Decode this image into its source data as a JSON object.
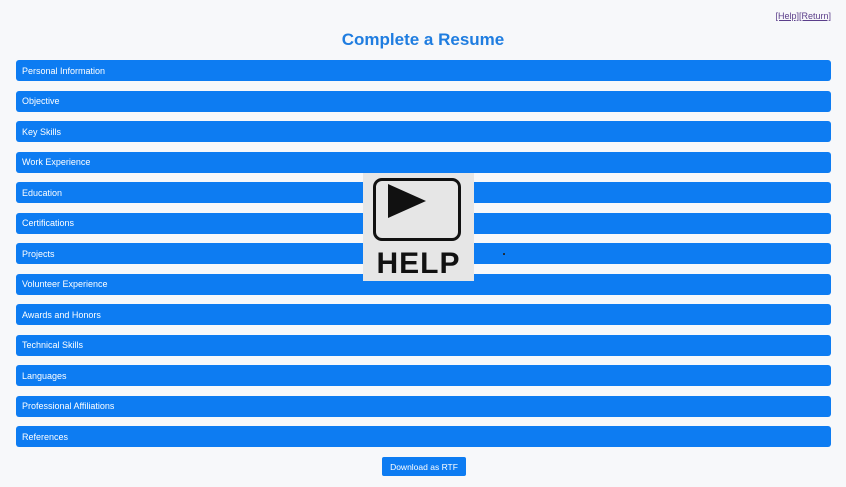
{
  "header": {
    "help_link": "[Help]",
    "return_link": "[Return]",
    "title": "Complete a Resume"
  },
  "sections": [
    {
      "label": "Personal Information"
    },
    {
      "label": "Objective"
    },
    {
      "label": "Key Skills"
    },
    {
      "label": "Work Experience"
    },
    {
      "label": "Education"
    },
    {
      "label": "Certifications"
    },
    {
      "label": "Projects"
    },
    {
      "label": "Volunteer Experience"
    },
    {
      "label": "Awards and Honors"
    },
    {
      "label": "Technical Skills"
    },
    {
      "label": "Languages"
    },
    {
      "label": "Professional Affiliations"
    },
    {
      "label": "References"
    }
  ],
  "footer": {
    "download_label": "Download as RTF"
  },
  "help_overlay": {
    "icon": "play-icon",
    "text": "HELP"
  },
  "colors": {
    "accent": "#0d7cf2",
    "title": "#1f7de0",
    "link": "#5b3e8a",
    "background": "#f7f8fa"
  }
}
